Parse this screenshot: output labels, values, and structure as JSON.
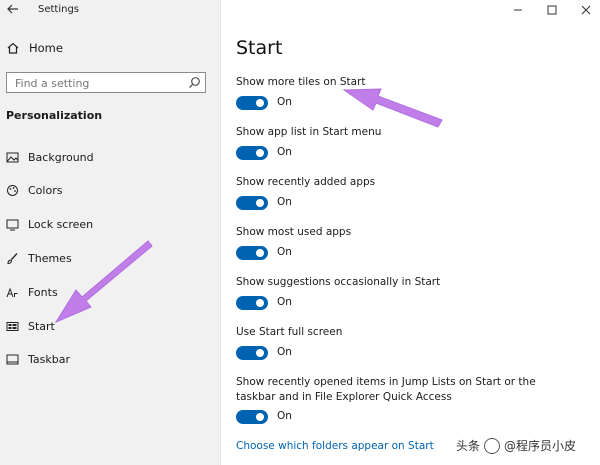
{
  "window": {
    "title": "Settings"
  },
  "sidebar": {
    "home_label": "Home",
    "search_placeholder": "Find a setting",
    "section_heading": "Personalization",
    "items": [
      {
        "label": "Background",
        "icon": "picture-icon"
      },
      {
        "label": "Colors",
        "icon": "palette-icon"
      },
      {
        "label": "Lock screen",
        "icon": "lock-screen-icon"
      },
      {
        "label": "Themes",
        "icon": "brush-icon"
      },
      {
        "label": "Fonts",
        "icon": "font-icon"
      },
      {
        "label": "Start",
        "icon": "start-tiles-icon"
      },
      {
        "label": "Taskbar",
        "icon": "taskbar-icon"
      }
    ]
  },
  "main": {
    "title": "Start",
    "settings": [
      {
        "label": "Show more tiles on Start",
        "state": "On"
      },
      {
        "label": "Show app list in Start menu",
        "state": "On"
      },
      {
        "label": "Show recently added apps",
        "state": "On"
      },
      {
        "label": "Show most used apps",
        "state": "On"
      },
      {
        "label": "Show suggestions occasionally in Start",
        "state": "On"
      },
      {
        "label": "Use Start full screen",
        "state": "On"
      },
      {
        "label": "Show recently opened items in Jump Lists on Start or the taskbar and in File Explorer Quick Access",
        "state": "On"
      }
    ],
    "link": "Choose which folders appear on Start"
  },
  "watermark": {
    "prefix": "头条",
    "suffix": "@程序员小皮"
  },
  "colors": {
    "accent": "#0063b1",
    "annotation": "#c27ee8",
    "sidebar_bg": "#f1f1f1"
  }
}
